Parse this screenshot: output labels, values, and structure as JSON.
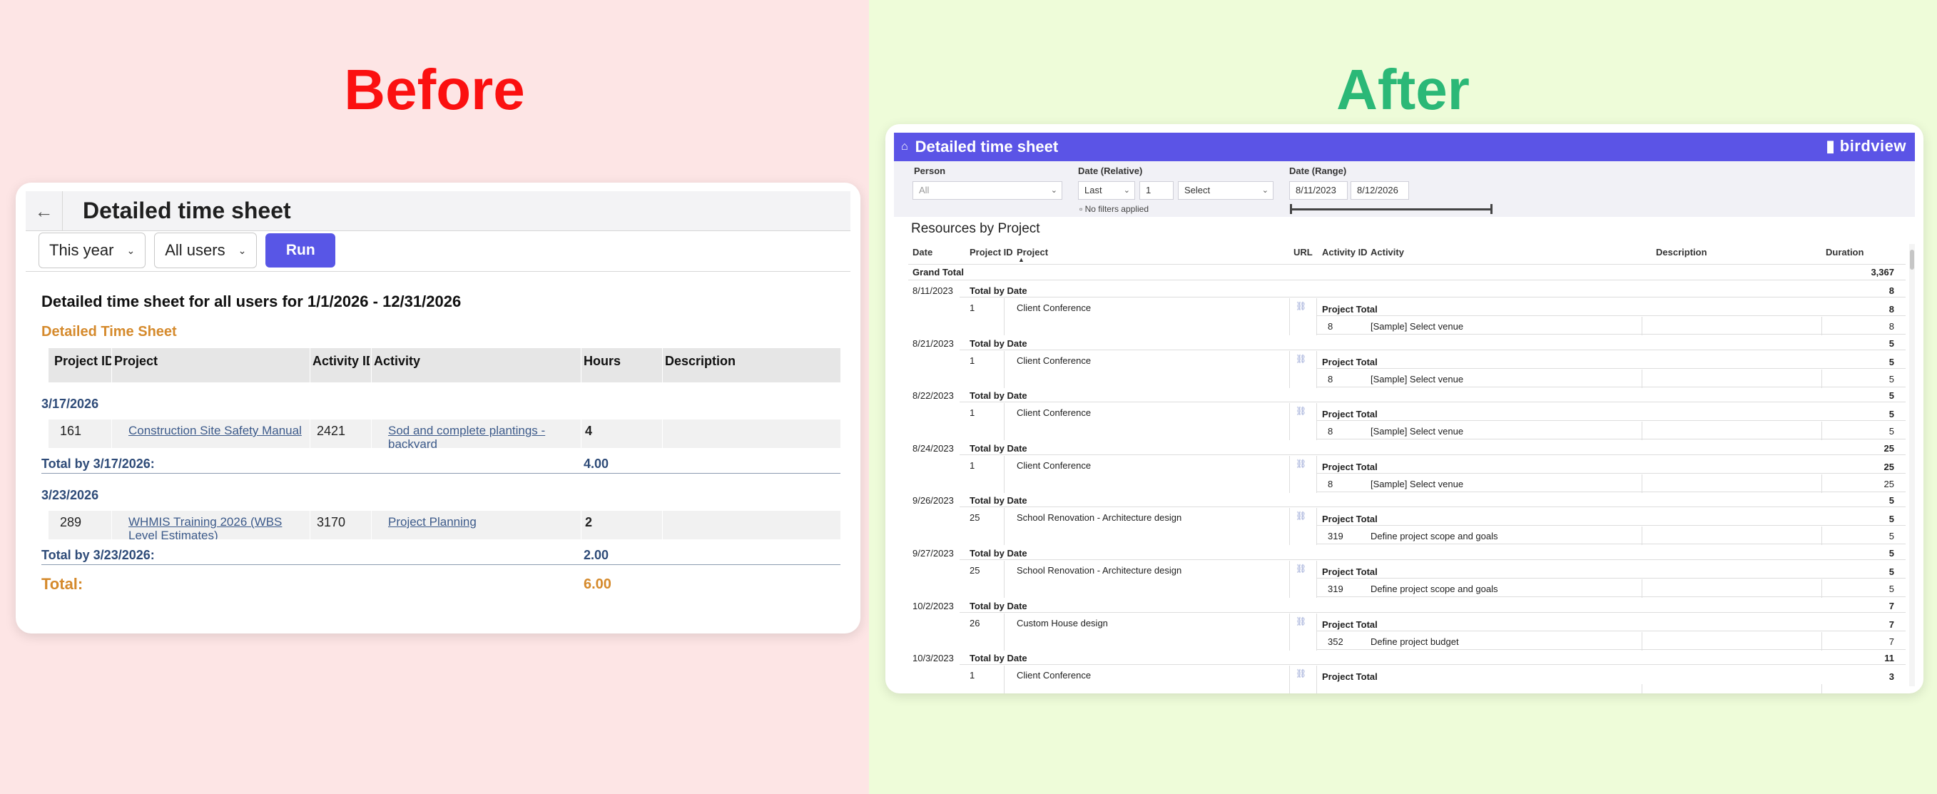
{
  "labels": {
    "before": "Before",
    "after": "After"
  },
  "before": {
    "back_icon": "arrow-left-icon",
    "title": "Detailed time sheet",
    "filters": {
      "period": "This year",
      "users": "All users",
      "run": "Run"
    },
    "report_title": "Detailed time sheet for all users for 1/1/2026 - 12/31/2026",
    "section_title": "Detailed Time Sheet",
    "columns": [
      "Project ID",
      "Project",
      "Activity ID",
      "Activity",
      "Hours",
      "Description"
    ],
    "groups": [
      {
        "date": "3/17/2026",
        "row": {
          "project_id": "161",
          "project": "Construction Site Safety Manual",
          "activity_id": "2421",
          "activity": "Sod and complete plantings - backyard",
          "hours": "4"
        },
        "total_label": "Total by 3/17/2026:",
        "total": "4.00"
      },
      {
        "date": "3/23/2026",
        "row": {
          "project_id": "289",
          "project": "WHMIS Training 2026 (WBS Level Estimates)",
          "activity_id": "3170",
          "activity": "Project Planning",
          "hours": "2"
        },
        "total_label": "Total by 3/23/2026:",
        "total": "2.00"
      }
    ],
    "grand_label": "Total:",
    "grand_total": "6.00"
  },
  "after": {
    "home_icon": "home-icon",
    "title": "Detailed time sheet",
    "logo": "birdview",
    "filters": {
      "person_label": "Person",
      "person_value": "All",
      "relative_label": "Date (Relative)",
      "relative_mode": "Last",
      "relative_count": "1",
      "relative_unit": "Select",
      "no_filters": "No filters applied",
      "range_label": "Date (Range)",
      "range_start": "8/11/2023",
      "range_end": "8/12/2026"
    },
    "subtitle": "Resources by Project",
    "columns": [
      "Date",
      "Project ID",
      "Project",
      "URL",
      "Activity ID",
      "Activity",
      "Description",
      "Duration"
    ],
    "grand_total_label": "Grand Total",
    "grand_total": "3,367",
    "total_by_date_label": "Total by Date",
    "project_total_label": "Project Total",
    "groups": [
      {
        "date": "8/11/2023",
        "date_total": "8",
        "project_id": "1",
        "project": "Client Conference",
        "project_total": "8",
        "activity_id": "8",
        "activity": "[Sample] Select venue",
        "duration": "8"
      },
      {
        "date": "8/21/2023",
        "date_total": "5",
        "project_id": "1",
        "project": "Client Conference",
        "project_total": "5",
        "activity_id": "8",
        "activity": "[Sample] Select venue",
        "duration": "5"
      },
      {
        "date": "8/22/2023",
        "date_total": "5",
        "project_id": "1",
        "project": "Client Conference",
        "project_total": "5",
        "activity_id": "8",
        "activity": "[Sample] Select venue",
        "duration": "5"
      },
      {
        "date": "8/24/2023",
        "date_total": "25",
        "project_id": "1",
        "project": "Client Conference",
        "project_total": "25",
        "activity_id": "8",
        "activity": "[Sample] Select venue",
        "duration": "25"
      },
      {
        "date": "9/26/2023",
        "date_total": "5",
        "project_id": "25",
        "project": "School Renovation - Architecture design",
        "project_total": "5",
        "activity_id": "319",
        "activity": "Define project scope and goals",
        "duration": "5"
      },
      {
        "date": "9/27/2023",
        "date_total": "5",
        "project_id": "25",
        "project": "School Renovation - Architecture design",
        "project_total": "5",
        "activity_id": "319",
        "activity": "Define project scope and goals",
        "duration": "5"
      },
      {
        "date": "10/2/2023",
        "date_total": "7",
        "project_id": "26",
        "project": "Custom House design",
        "project_total": "7",
        "activity_id": "352",
        "activity": "Define project budget",
        "duration": "7"
      },
      {
        "date": "10/3/2023",
        "date_total": "11",
        "project_id": "1",
        "project": "Client Conference",
        "project_total": "3"
      }
    ]
  }
}
